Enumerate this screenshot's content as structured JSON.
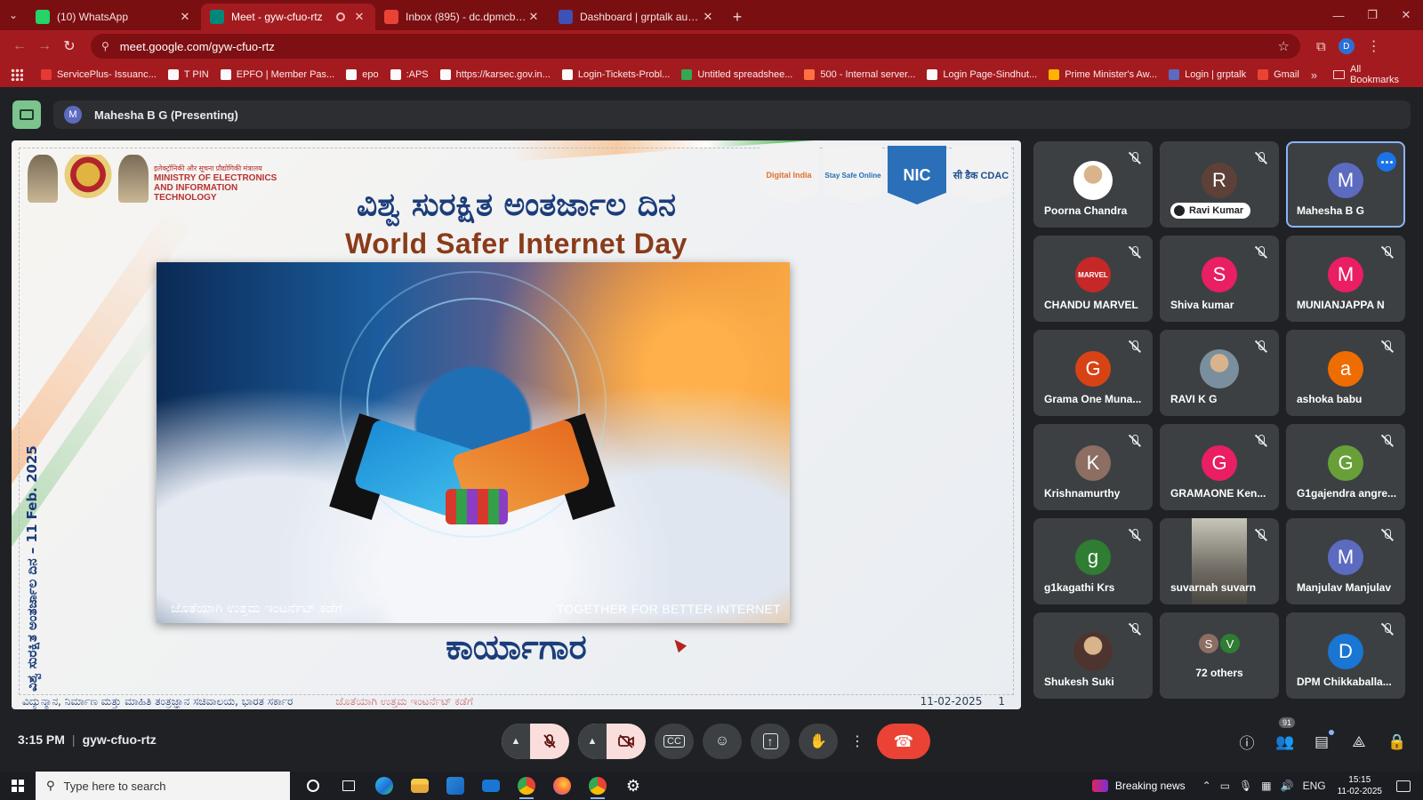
{
  "browser": {
    "tabs": [
      {
        "label": "(10) WhatsApp",
        "favicon_color": "#25d366",
        "active": false,
        "recording": false
      },
      {
        "label": "Meet - gyw-cfuo-rtz",
        "favicon_color": "#00897b",
        "active": true,
        "recording": true
      },
      {
        "label": "Inbox (895) - dc.dpmcbp@gma",
        "favicon_color": "#ea4335",
        "active": false,
        "recording": false
      },
      {
        "label": "Dashboard | grptalk audio conf",
        "favicon_color": "#3f51b5",
        "active": false,
        "recording": false
      }
    ],
    "new_tab_symbol": "+",
    "url": "meet.google.com/gyw-cfuo-rtz",
    "profile_initial": "D",
    "bookmarks": [
      {
        "label": "ServicePlus- Issuanc...",
        "color": "#e53935"
      },
      {
        "label": "T PIN",
        "color": "#fafafa"
      },
      {
        "label": "EPFO | Member Pas...",
        "color": "#fafafa"
      },
      {
        "label": "epo",
        "color": "#fafafa"
      },
      {
        "label": ":APS",
        "color": "#fafafa"
      },
      {
        "label": "https://karsec.gov.in...",
        "color": "#fafafa"
      },
      {
        "label": "Login-Tickets-Probl...",
        "color": "#fafafa"
      },
      {
        "label": "Untitled spreadshee...",
        "color": "#34a853"
      },
      {
        "label": "500 - Internal server...",
        "color": "#ff7043"
      },
      {
        "label": "Login Page-Sindhut...",
        "color": "#fafafa"
      },
      {
        "label": "Prime Minister's Aw...",
        "color": "#ffb300"
      },
      {
        "label": "Login | grptalk",
        "color": "#5c6bc0"
      },
      {
        "label": "Gmail",
        "color": "#ea4335"
      }
    ],
    "bookmarks_more": "»",
    "all_bookmarks": "All Bookmarks"
  },
  "meet": {
    "presenter_initial": "M",
    "presenter_label": "Mahesha B G (Presenting)",
    "slide": {
      "ministry_hindi": "इलेक्ट्रॉनिकी और सूचना प्रौद्योगिकी मंत्रालय",
      "ministry_en": "MINISTRY OF ELECTRONICS AND INFORMATION TECHNOLOGY",
      "logos": [
        "Digital India",
        "Stay Safe Online",
        "NIC",
        "सी डैक CDAC"
      ],
      "title_kn": "ವಿಶ್ವ ಸುರಕ್ಷಿತ ಅಂತರ್ಜಾಲ ದಿನ",
      "title_en": "World Safer Internet Day",
      "caption_kn": "ಜೊತೆಯಾಗಿ ಉತ್ತಮ ಇಂಟರ್ನೆಟ್ ಕಡೆಗೆ",
      "caption_en": "TOGETHER FOR BETTER INTERNET",
      "vertical_text": "ವಿಶ್ವ ಸುರಕ್ಷಿತ ಅಂತರ್ಜಾಲ ದಿನ – 11 Feb. 2025",
      "workshop": "ಕಾರ್ಯಾಗಾರ",
      "footer_left": "ವಿದ್ಯುನ್ಮಾನ, ನಿರ್ಮಾಣ ಮತ್ತು ಮಾಹಿತಿ ತಂತ್ರಜ್ಞಾನ ಸಚಿವಾಲಯ, ಭಾರತ ಸರ್ಕಾರ",
      "footer_mid": "ಜೊತೆಯಾಗಿ ಉತ್ತಮ ಇಂಟರ್ನೆಟ್ ಕಡೆಗೆ",
      "footer_date": "11-02-2025",
      "footer_page": "1"
    },
    "participants": [
      {
        "name": "Poorna Chandra",
        "initial": "",
        "color": "#ffffff",
        "muted": true,
        "kind": "photo"
      },
      {
        "name": "Ravi Kumar",
        "initial": "R",
        "color": "#5d4037",
        "muted": true,
        "kind": "chip"
      },
      {
        "name": "Mahesha B G",
        "initial": "M",
        "color": "#5c6bc0",
        "muted": false,
        "kind": "speaking"
      },
      {
        "name": "CHANDU MARVEL",
        "initial": "MARVEL",
        "color": "#c62828",
        "muted": true,
        "kind": "logo"
      },
      {
        "name": "Shiva kumar",
        "initial": "S",
        "color": "#e91e63",
        "muted": true,
        "kind": "letter"
      },
      {
        "name": "MUNIANJAPPA N",
        "initial": "M",
        "color": "#e91e63",
        "muted": true,
        "kind": "letter"
      },
      {
        "name": "Grama One Muna...",
        "initial": "G",
        "color": "#d84315",
        "muted": true,
        "kind": "letter"
      },
      {
        "name": "RAVI K G",
        "initial": "",
        "color": "#7a8f9e",
        "muted": true,
        "kind": "photo"
      },
      {
        "name": "ashoka babu",
        "initial": "a",
        "color": "#ef6c00",
        "muted": true,
        "kind": "letter"
      },
      {
        "name": "Krishnamurthy",
        "initial": "K",
        "color": "#8d6e63",
        "muted": true,
        "kind": "letter"
      },
      {
        "name": "GRAMAONE Ken...",
        "initial": "G",
        "color": "#e91e63",
        "muted": true,
        "kind": "letter"
      },
      {
        "name": "G1gajendra angre...",
        "initial": "G",
        "color": "#689f38",
        "muted": true,
        "kind": "letter"
      },
      {
        "name": "g1kagathi Krs",
        "initial": "g",
        "color": "#2e7d32",
        "muted": true,
        "kind": "letter"
      },
      {
        "name": "suvarnah suvarn",
        "initial": "",
        "color": "#8a8678",
        "muted": true,
        "kind": "video"
      },
      {
        "name": "Manjulav Manjulav",
        "initial": "M",
        "color": "#5c6bc0",
        "muted": true,
        "kind": "letter"
      },
      {
        "name": "Shukesh Suki",
        "initial": "",
        "color": "#4e342e",
        "muted": true,
        "kind": "photo"
      },
      {
        "name": "72 others",
        "initial": "S",
        "initial2": "V",
        "color": "#8d6e63",
        "color2": "#2e7d32",
        "muted": false,
        "kind": "others"
      },
      {
        "name": "DPM Chikkaballa...",
        "initial": "D",
        "color": "#1976d2",
        "muted": true,
        "kind": "letter"
      }
    ],
    "time": "3:15 PM",
    "meeting_code": "gyw-cfuo-rtz",
    "people_count": "91"
  },
  "taskbar": {
    "search_placeholder": "Type here to search",
    "news": "Breaking news",
    "lang": "ENG",
    "time": "15:15",
    "date": "11-02-2025"
  }
}
